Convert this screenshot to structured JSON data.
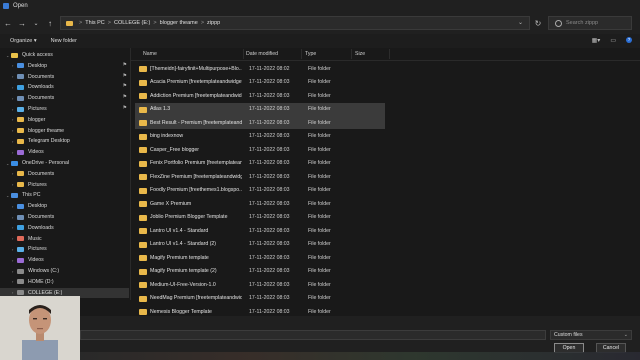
{
  "window": {
    "title": "Open"
  },
  "nav": {
    "back_icon": "arrow-left-icon",
    "forward_icon": "arrow-right-icon",
    "recent_icon": "chevron-down-icon",
    "up_icon": "arrow-up-icon"
  },
  "address": {
    "crumbs": [
      "This PC",
      "COLLEGE (E:)",
      "blogger theame",
      "zippp"
    ],
    "separator": ">"
  },
  "search": {
    "placeholder": "Search zippp"
  },
  "toolbar": {
    "organize_label": "Organize ▾",
    "new_folder_label": "New folder"
  },
  "sidebar": {
    "items": [
      {
        "label": "Quick access",
        "icon": "star-icon",
        "level": 0,
        "pinned": false
      },
      {
        "label": "Desktop",
        "icon": "desktop-icon",
        "level": 1,
        "pinned": true
      },
      {
        "label": "Documents",
        "icon": "documents-icon",
        "level": 1,
        "pinned": true
      },
      {
        "label": "Downloads",
        "icon": "downloads-icon",
        "level": 1,
        "pinned": true
      },
      {
        "label": "Documents",
        "icon": "documents-icon",
        "level": 1,
        "pinned": true
      },
      {
        "label": "Pictures",
        "icon": "pictures-icon",
        "level": 1,
        "pinned": true
      },
      {
        "label": "blogger",
        "icon": "folder-icon",
        "level": 1,
        "pinned": false
      },
      {
        "label": "blogger theame",
        "icon": "folder-icon",
        "level": 1,
        "pinned": false
      },
      {
        "label": "Telegram Desktop",
        "icon": "folder-icon",
        "level": 1,
        "pinned": false
      },
      {
        "label": "Videos",
        "icon": "videos-icon",
        "level": 1,
        "pinned": false
      },
      {
        "label": "OneDrive - Personal",
        "icon": "cloud-icon",
        "level": 0,
        "pinned": false
      },
      {
        "label": "Documents",
        "icon": "folder-icon",
        "level": 1,
        "pinned": false
      },
      {
        "label": "Pictures",
        "icon": "folder-icon",
        "level": 1,
        "pinned": false
      },
      {
        "label": "This PC",
        "icon": "pc-icon",
        "level": 0,
        "pinned": false
      },
      {
        "label": "Desktop",
        "icon": "desktop-icon",
        "level": 1,
        "pinned": false
      },
      {
        "label": "Documents",
        "icon": "documents-icon",
        "level": 1,
        "pinned": false
      },
      {
        "label": "Downloads",
        "icon": "downloads-icon",
        "level": 1,
        "pinned": false
      },
      {
        "label": "Music",
        "icon": "music-icon",
        "level": 1,
        "pinned": false
      },
      {
        "label": "Pictures",
        "icon": "pictures-icon",
        "level": 1,
        "pinned": false
      },
      {
        "label": "Videos",
        "icon": "videos-icon",
        "level": 1,
        "pinned": false
      },
      {
        "label": "Windows (C:)",
        "icon": "drive-icon",
        "level": 1,
        "pinned": false
      },
      {
        "label": "HOME (D:)",
        "icon": "drive-icon",
        "level": 1,
        "pinned": false
      },
      {
        "label": "COLLEGE (E:)",
        "icon": "drive-icon",
        "level": 1,
        "pinned": false,
        "selected": true
      }
    ]
  },
  "columns": {
    "name": "Name",
    "date": "Date modified",
    "type": "Type",
    "size": "Size"
  },
  "files": [
    {
      "name": "[Themeidn]-fairyfinit+Multipurpose+Blo...",
      "date": "17-11-2022 08:02",
      "type": "File folder"
    },
    {
      "name": "Acacia Premium [freetemplateandwidget...",
      "date": "17-11-2022 08:03",
      "type": "File folder"
    },
    {
      "name": "Addiction Premium [freetemplateandwid...",
      "date": "17-11-2022 08:03",
      "type": "File folder"
    },
    {
      "name": "Atlas 1.3",
      "date": "17-11-2022 08:03",
      "type": "File folder",
      "highlight": true
    },
    {
      "name": "Best Result - Premium [freetemplateand...",
      "date": "17-11-2022 08:03",
      "type": "File folder",
      "highlight": true
    },
    {
      "name": "bing indexnow",
      "date": "17-11-2022 08:03",
      "type": "File folder"
    },
    {
      "name": "Casper_Free blogger",
      "date": "17-11-2022 08:03",
      "type": "File folder"
    },
    {
      "name": "Fenix Portfolio Premium [freetemplatean...",
      "date": "17-11-2022 08:03",
      "type": "File folder"
    },
    {
      "name": "FlexZine Premium [freetemplateandwidg...",
      "date": "17-11-2022 08:03",
      "type": "File folder"
    },
    {
      "name": "Foodly Premium [freethemes1.blogspo...",
      "date": "17-11-2022 08:03",
      "type": "File folder"
    },
    {
      "name": "Game X Premium",
      "date": "17-11-2022 08:03",
      "type": "File folder"
    },
    {
      "name": "Joblio Premium Blogger Template",
      "date": "17-11-2022 08:03",
      "type": "File folder"
    },
    {
      "name": "Lantro UI v1.4 - Standard",
      "date": "17-11-2022 08:03",
      "type": "File folder"
    },
    {
      "name": "Lantro UI v1.4 - Standard (2)",
      "date": "17-11-2022 08:03",
      "type": "File folder"
    },
    {
      "name": "Magify Premium template",
      "date": "17-11-2022 08:03",
      "type": "File folder"
    },
    {
      "name": "Magify Premium template (2)",
      "date": "17-11-2022 08:03",
      "type": "File folder"
    },
    {
      "name": "Medium-UI-Free-Version-1.0",
      "date": "17-11-2022 08:03",
      "type": "File folder"
    },
    {
      "name": "NeedMag Premium [freetemplateandwid...",
      "date": "17-11-2022 08:03",
      "type": "File folder"
    },
    {
      "name": "Nemesis Blogger Template",
      "date": "17-11-2022 08:03",
      "type": "File folder"
    }
  ],
  "footer": {
    "file_type_label": "Custom files",
    "open_label": "Open",
    "cancel_label": "Cancel"
  },
  "colors": {
    "folder": "#e9b84a",
    "background": "#191919",
    "highlight_row": "#3b3b3b"
  }
}
